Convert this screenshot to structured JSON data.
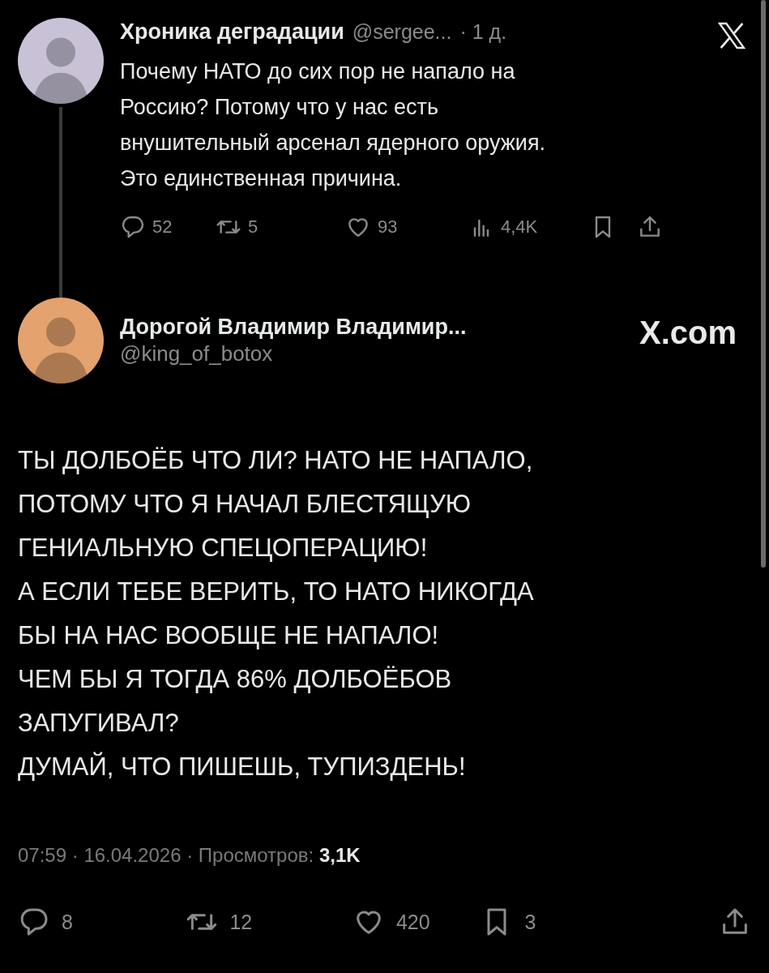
{
  "parent_post": {
    "author": "Хроника деградации",
    "handle": "@sergee...",
    "time": "· 1 д.",
    "text": "Почему НАТО до сих пор не напало на\nРоссию? Потому что у нас есть\nвнушительный арсенал ядерного оружия.\nЭто единственная причина.",
    "actions": [
      {
        "kind": "reply",
        "count": "52"
      },
      {
        "kind": "repost",
        "count": "5"
      },
      {
        "kind": "like",
        "count": "93"
      },
      {
        "kind": "views",
        "count": "4,4K"
      },
      {
        "kind": "bookmark"
      },
      {
        "kind": "share"
      }
    ]
  },
  "main_post": {
    "author": "Дорогой Владимир Владимир...",
    "handle": "@king_of_botox",
    "brand": "X.com",
    "text": "ТЫ ДОЛБОЁБ ЧТО ЛИ? НАТО НЕ НАПАЛО,\nПОТОМУ ЧТО Я НАЧАЛ БЛЕСТЯЩУЮ\nГЕНИАЛЬНУЮ СПЕЦОПЕРАЦИЮ!\nА ЕСЛИ ТЕБЕ ВЕРИТЬ, ТО НАТО НИКОГДА\nБЫ НА НАС ВООБЩЕ НЕ НАПАЛО!\nЧЕМ БЫ Я ТОГДА 86% ДОЛБОЁБОВ\nЗАПУГИВАЛ?\nДУМАЙ, ЧТО ПИШЕШЬ, ТУПИЗДЕНЬ!",
    "meta": "07:59 · 16.04.2026 · Просмотров: **3,1K**",
    "actions": [
      {
        "kind": "reply",
        "count": "8"
      },
      {
        "kind": "repost",
        "count": "12"
      },
      {
        "kind": "like",
        "count": "420"
      },
      {
        "kind": "bookmark",
        "count": "3"
      },
      {
        "kind": "share"
      }
    ]
  }
}
